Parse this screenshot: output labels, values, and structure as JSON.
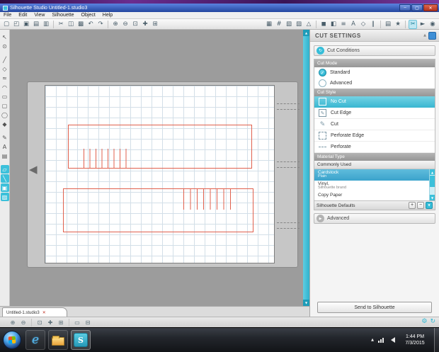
{
  "window": {
    "title": "Silhouette Studio Untitled-1.studio3"
  },
  "menu": {
    "items": [
      "File",
      "Edit",
      "View",
      "Silhouette",
      "Object",
      "Help"
    ]
  },
  "toolbar_left": [
    "▢",
    "◰",
    "▣",
    "▤",
    "▥",
    "✂",
    "◫",
    "▩",
    "↶",
    "↷",
    "⊕",
    "⊖",
    "⊡",
    "✚",
    "⊞"
  ],
  "toolbar_right_a": [
    "▦",
    "#",
    "▧",
    "▨",
    "△"
  ],
  "toolbar_right_b": [
    "◼",
    "◧",
    "≡",
    "A",
    "◇",
    "∥"
  ],
  "toolbar_right_c": [
    "▤",
    "★"
  ],
  "toolbar_right_d": [
    "✂",
    "►",
    "◉"
  ],
  "palette": [
    "↖",
    "⊙",
    "╱",
    "◇",
    "≈",
    "◠",
    "▭",
    "▢",
    "◯",
    "◆",
    "✎",
    "A",
    "▤",
    "▱",
    "╲",
    "▣",
    "▨"
  ],
  "bottom_tools": [
    "⊕",
    "⊖",
    "⊡",
    "✚",
    "⊞",
    "▭",
    "⊟"
  ],
  "panel": {
    "title": "CUT SETTINGS",
    "cut_conditions_label": "Cut Conditions",
    "cut_mode_label": "Cut Mode",
    "modes": [
      {
        "label": "Standard",
        "selected": true
      },
      {
        "label": "Advanced",
        "selected": false
      }
    ],
    "cut_style_label": "Cut Style",
    "styles": [
      {
        "label": "No Cut",
        "selected": true
      },
      {
        "label": "Cut Edge",
        "selected": false
      },
      {
        "label": "Cut",
        "selected": false
      },
      {
        "label": "Perforate Edge",
        "selected": false
      },
      {
        "label": "Perforate",
        "selected": false
      }
    ],
    "material_type_label": "Material Type",
    "material_group": "Commonly Used",
    "materials": [
      {
        "name": "Cardstock",
        "sub": "Plain",
        "selected": true
      },
      {
        "name": "Vinyl,",
        "sub": "Silhouette brand",
        "selected": false
      },
      {
        "name": "Copy Paper",
        "sub": "",
        "selected": false
      }
    ],
    "defaults_label": "Silhouette Defaults",
    "advanced_label": "Advanced",
    "send_button": "Send to Silhouette"
  },
  "document_tab": {
    "label": "Untitled-1.studio3"
  },
  "taskbar": {
    "time": "1:44 PM",
    "date": "7/3/2015"
  },
  "icons": {
    "window_minimize": "–",
    "window_maximize": "▢",
    "window_close": "✕",
    "tab_close": "✕",
    "collapse_up": "▲",
    "expand_right": "▶",
    "scroll_up": "▲",
    "scroll_down": "▼",
    "check": "✓",
    "plus": "+",
    "minus": "−",
    "reset": "↻",
    "gear": "⚙",
    "left_arrow": "◀",
    "silhouette_logo": "S",
    "ie_logo": "e"
  },
  "colors": {
    "accent_teal": "#3cc0da",
    "selection_blue": "#4fb0d6",
    "design_red": "#e0604d",
    "titlebar_blue": "#2a5ad4"
  }
}
